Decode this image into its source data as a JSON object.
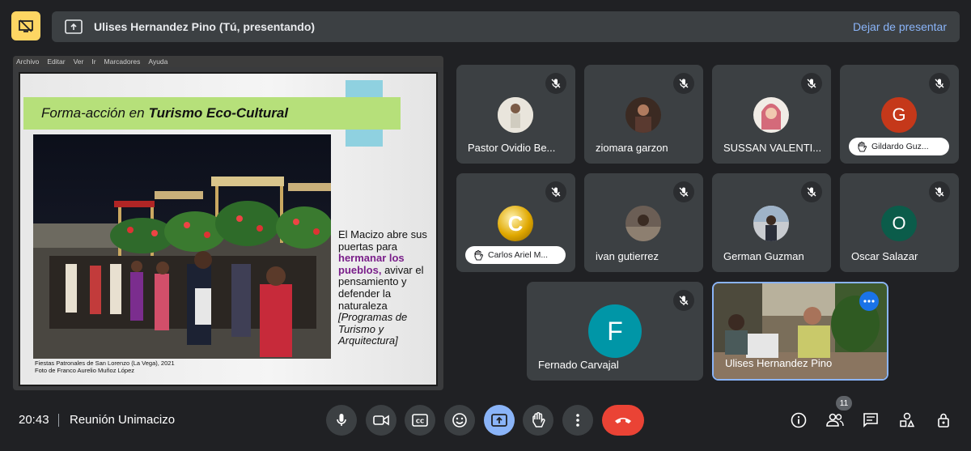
{
  "presenting": {
    "presenter_label": "Ulises Hernandez Pino (Tú, presentando)",
    "stop_label": "Dejar de presentar"
  },
  "presentation_window": {
    "menu": [
      "Archivo",
      "Editar",
      "Ver",
      "Ir",
      "Marcadores",
      "Ayuda"
    ],
    "slide": {
      "title_plain": "Forma-acción en",
      "title_bold": "Turismo Eco-Cultural",
      "caption_line1": "Fiestas Patronales de San Lorenzo (La Vega), 2021",
      "caption_line2": "Foto de Franco Aurelio Muñoz López",
      "body_1": "El Macizo abre sus puertas para",
      "body_highlight": "hermanar los pueblos,",
      "body_2": "avivar el pensamiento y defender la naturaleza",
      "body_italic": "[Programas de Turismo y Arquitectura]"
    }
  },
  "participants": [
    {
      "name": "Pastor Ovidio Be...",
      "muted": true
    },
    {
      "name": "ziomara garzon",
      "muted": true
    },
    {
      "name": "SUSSAN VALENTI...",
      "muted": true
    },
    {
      "name": "Gildardo Guz...",
      "initial": "G",
      "muted": true,
      "hand_raised": true,
      "avatar_color": "#c5381a"
    },
    {
      "name": "Carlos Ariel M...",
      "initial": "C",
      "muted": true,
      "hand_raised": true
    },
    {
      "name": "ivan gutierrez",
      "muted": true
    },
    {
      "name": "German Guzman",
      "muted": true
    },
    {
      "name": "Oscar Salazar",
      "initial": "O",
      "muted": true,
      "avatar_color": "#0b5c4a"
    },
    {
      "name": "Fernado Carvajal",
      "initial": "F",
      "muted": true,
      "avatar_color": "#0096a7"
    },
    {
      "name": "Ulises Hernandez Pino",
      "self": true
    }
  ],
  "bottom": {
    "time": "20:43",
    "meeting_name": "Reunión Unimacizo",
    "people_count": "11"
  },
  "colors": {
    "accent": "#8ab4f8",
    "end_call": "#ea4335",
    "present_active": "#8ab4f8",
    "top_badge": "#fdd663"
  }
}
